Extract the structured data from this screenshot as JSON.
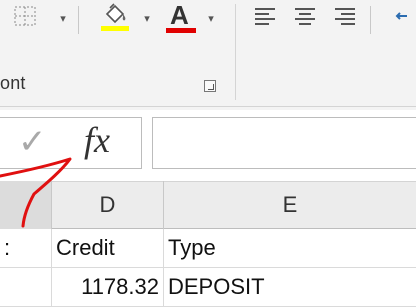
{
  "ribbon": {
    "group_label": "ont",
    "borders_icon": "borders-icon",
    "fill_color_icon": "paint-bucket-icon",
    "fill_color_value": "#FFFF00",
    "font_color_letter": "A",
    "font_color_value": "#E00000",
    "align_icons": [
      "align-left-icon",
      "align-center-icon",
      "align-right-icon"
    ],
    "wrap_icon": "wrap-text-icon",
    "dropdown_glyph": "▾"
  },
  "formula_bar": {
    "enter_glyph": "✓",
    "fx_label": "fx",
    "value": ""
  },
  "columns": [
    {
      "id": "C",
      "label": ""
    },
    {
      "id": "D",
      "label": "D"
    },
    {
      "id": "E",
      "label": "E"
    }
  ],
  "rows": [
    {
      "c": ":",
      "d": "Credit",
      "e": "Type"
    },
    {
      "c": "",
      "d": "1178.32",
      "e": "DEPOSIT"
    }
  ],
  "annotation_color": "#e01010"
}
